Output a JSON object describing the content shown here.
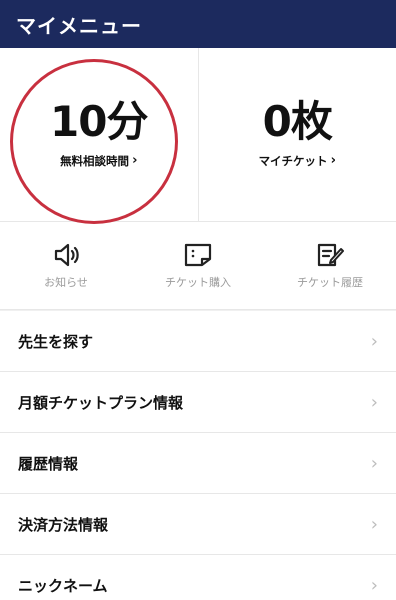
{
  "header": {
    "title": "マイメニュー"
  },
  "stats": [
    {
      "value": "10分",
      "label": "無料相談時間",
      "chevron": "›"
    },
    {
      "value": "0枚",
      "label": "マイチケット",
      "chevron": "›"
    }
  ],
  "shortcuts": [
    {
      "label": "お知らせ",
      "icon": "speaker-icon"
    },
    {
      "label": "チケット購入",
      "icon": "ticket-purchase-icon"
    },
    {
      "label": "チケット履歴",
      "icon": "edit-history-icon"
    }
  ],
  "menu": [
    {
      "label": "先生を探す"
    },
    {
      "label": "月額チケットプラン情報"
    },
    {
      "label": "履歴情報"
    },
    {
      "label": "決済方法情報"
    },
    {
      "label": "ニックネーム"
    }
  ],
  "menu_arrow": "›",
  "colors": {
    "header": "#1c2a5e",
    "highlight": "#c8303f",
    "muted": "#9b9b9b"
  }
}
